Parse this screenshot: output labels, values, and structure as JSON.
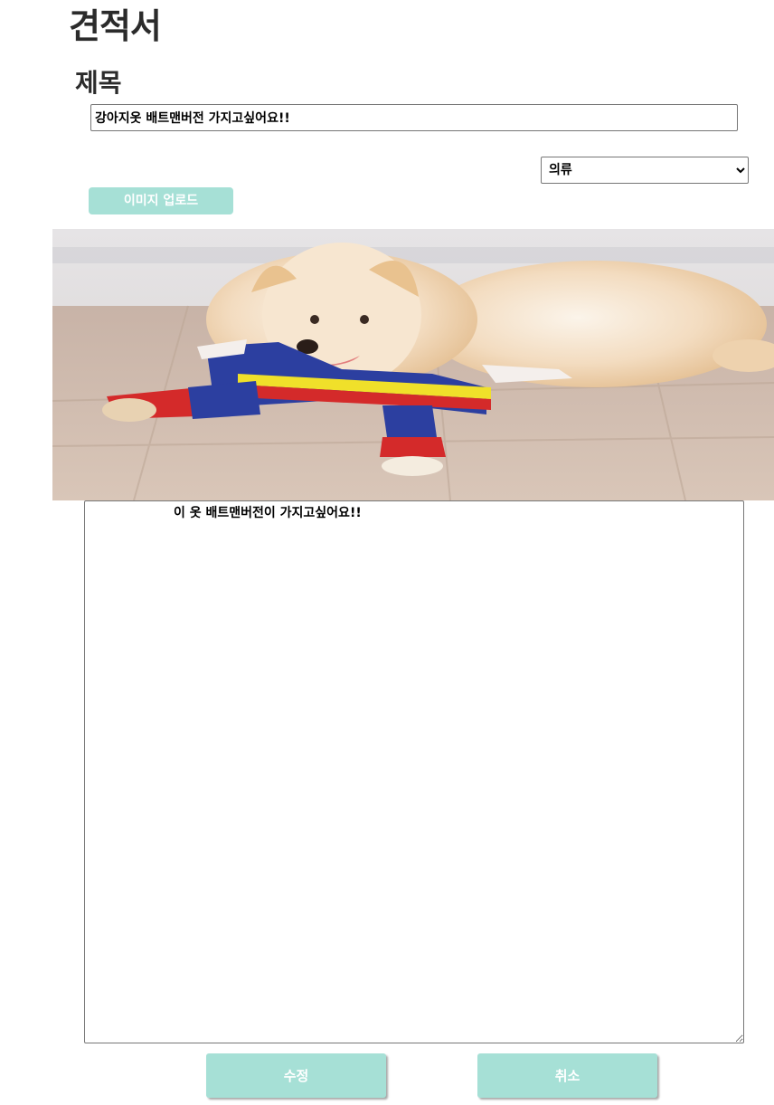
{
  "page": {
    "title": "견적서"
  },
  "form": {
    "title_label": "제목",
    "title_value": "강아지옷 배트맨버전 가지고싶어요!!",
    "category": {
      "selected": "의류",
      "options": [
        "의류"
      ]
    },
    "upload_button_label": "이미지 업로드",
    "content_value": "이 옷 배트맨버전이 가지고싶어요!!"
  },
  "actions": {
    "edit_label": "수정",
    "cancel_label": "취소"
  },
  "colors": {
    "button_accent": "#a6e0d6",
    "button_text": "#ffffff"
  },
  "image": {
    "semantic": "dog-in-costume-photo"
  }
}
